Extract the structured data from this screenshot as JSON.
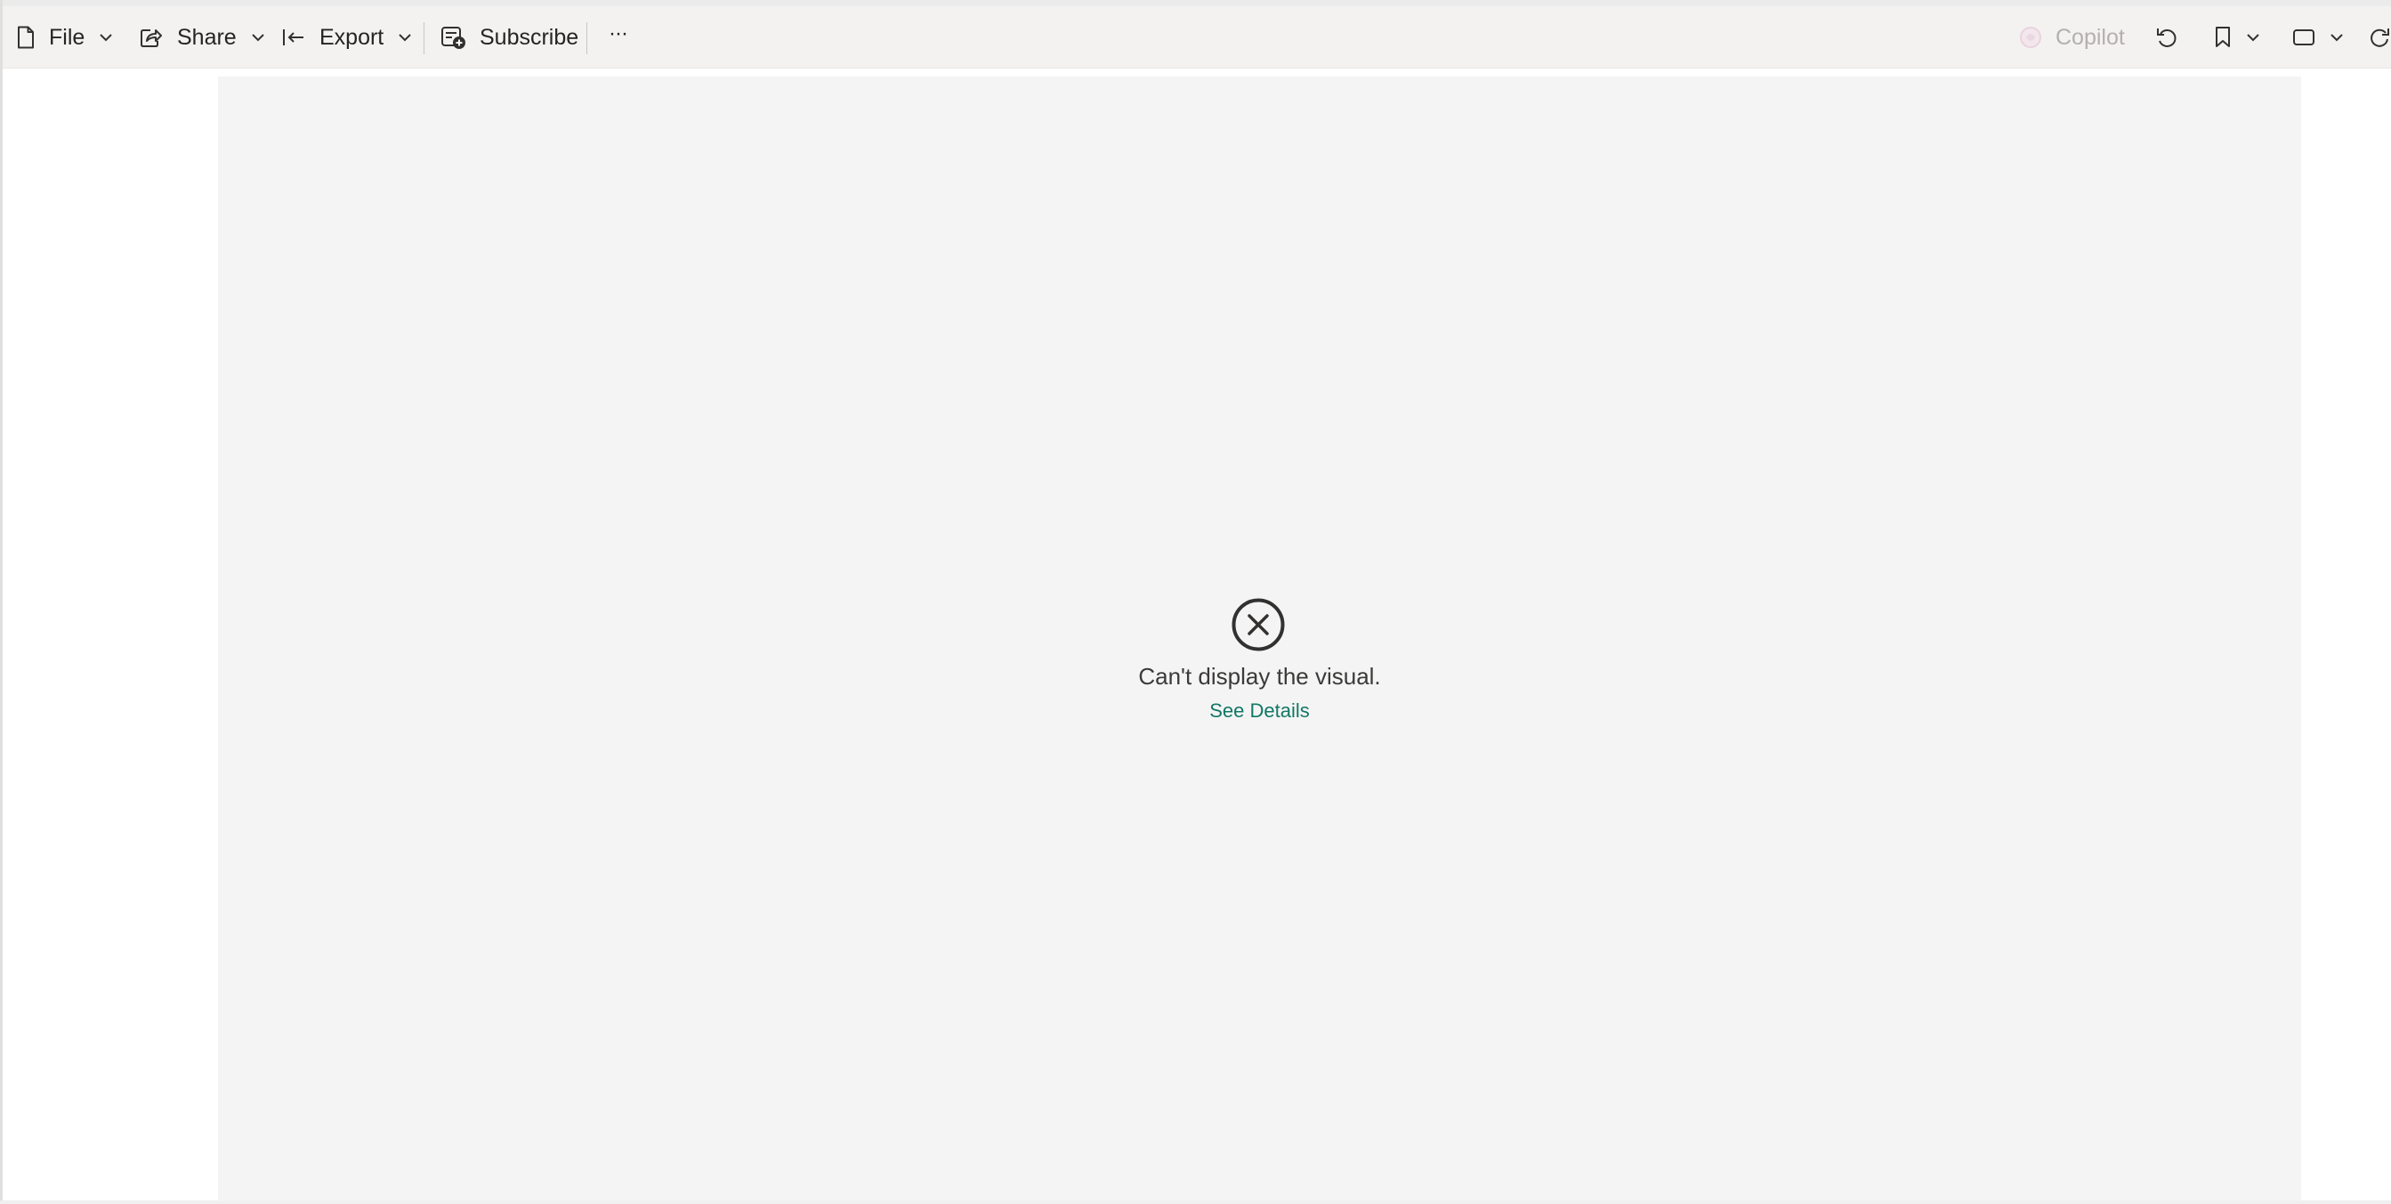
{
  "toolbar": {
    "file_label": "File",
    "share_label": "Share",
    "export_label": "Export",
    "subscribe_label": "Subscribe",
    "more_label": "···",
    "copilot_label": "Copilot",
    "icons": {
      "file": "document-icon",
      "share": "share-icon",
      "export": "export-icon",
      "subscribe": "subscribe-icon",
      "copilot": "copilot-icon",
      "reset": "undo-icon",
      "bookmark": "bookmark-icon",
      "view": "view-icon",
      "refresh": "refresh-icon"
    }
  },
  "visual": {
    "error_message": "Can't display the visual.",
    "details_link": "See Details"
  },
  "colors": {
    "toolbar_bg": "#f3f2f1",
    "canvas_bg": "#f4f4f4",
    "link": "#117865",
    "disabled_text": "#b3b0ad"
  }
}
